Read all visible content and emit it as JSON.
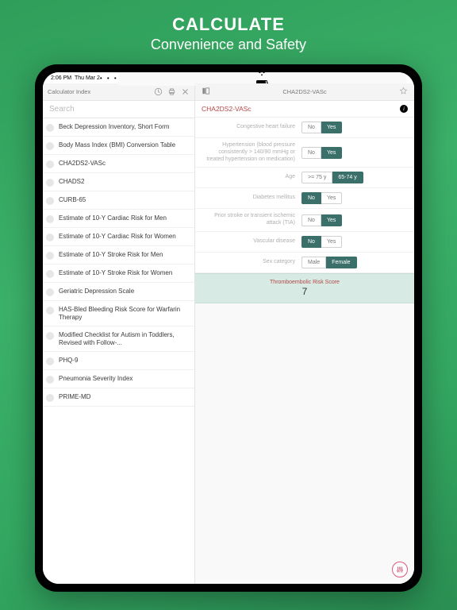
{
  "caption": {
    "line1": "CALCULATE",
    "line2": "Convenience and Safety"
  },
  "statusbar": {
    "time": "2:06 PM",
    "date": "Thu Mar 2",
    "dots": "• • •"
  },
  "left": {
    "title": "Calculator Index",
    "search_placeholder": "Search",
    "items": [
      "Beck Depression Inventory, Short Form",
      "Body Mass Index (BMI) Conversion Table",
      "CHA2DS2-VASc",
      "CHADS2",
      "CURB-65",
      "Estimate of 10-Y Cardiac Risk for Men",
      "Estimate of 10-Y Cardiac Risk for Women",
      "Estimate of 10-Y Stroke Risk for Men",
      "Estimate of 10-Y Stroke Risk for Women",
      "Geriatric Depression Scale",
      "HAS-Bled Bleeding Risk Score for Warfarin Therapy",
      "Modified Checklist for Autism in Toddlers, Revised with Follow-...",
      "PHQ-9",
      "Pneumonia Severity Index",
      "PRIME-MD"
    ]
  },
  "right": {
    "header_title": "CHA2DS2-VASc",
    "calc_name": "CHA2DS2-VASc",
    "fields": [
      {
        "label": "Congestive heart failure",
        "options": [
          "No",
          "Yes"
        ],
        "selected": 1
      },
      {
        "label": "Hypertension (blood pressure consistently > 140/90 mmHg or treated hypertension on medication)",
        "options": [
          "No",
          "Yes"
        ],
        "selected": 1
      },
      {
        "label": "Age",
        "options": [
          ">= 75 y",
          "65-74 y"
        ],
        "selected": 1
      },
      {
        "label": "Diabetes mellitus",
        "options": [
          "No",
          "Yes"
        ],
        "selected": 0
      },
      {
        "label": "Prior stroke or transient ischemic attack (TIA)",
        "options": [
          "No",
          "Yes"
        ],
        "selected": 1
      },
      {
        "label": "Vascular disease",
        "options": [
          "No",
          "Yes"
        ],
        "selected": 0
      },
      {
        "label": "Sex category",
        "options": [
          "Male",
          "Female"
        ],
        "selected": 1
      }
    ],
    "result": {
      "label": "Thromboembolic Risk Score",
      "value": "7"
    }
  }
}
